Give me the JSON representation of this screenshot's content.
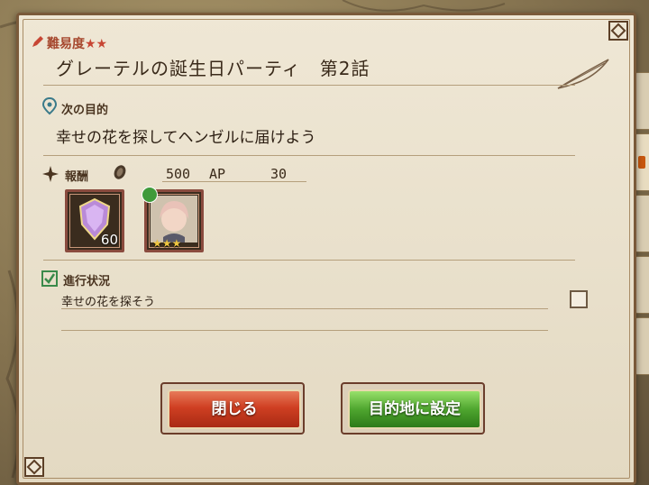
{
  "quest": {
    "difficulty_label": "難易度",
    "difficulty_stars": "★★",
    "title": "グレーテルの誕生日パーティ　第2話"
  },
  "goal": {
    "label": "次の目的",
    "text": "幸せの花を探してヘンゼルに届けよう"
  },
  "reward": {
    "label": "報酬",
    "coin_amount": "500",
    "ap_label": "AP",
    "ap_amount": "30",
    "items": [
      {
        "icon": "crystal-shield-icon",
        "count": "60"
      },
      {
        "icon": "character-portrait-icon",
        "rarity": "★★★"
      }
    ]
  },
  "progress": {
    "label": "進行状況",
    "tasks": [
      {
        "text": "幸せの花を探そう",
        "checked": false
      }
    ]
  },
  "buttons": {
    "close_label": "閉じる",
    "set_destination_label": "目的地に設定"
  },
  "colors": {
    "close_button": "#cf3f22",
    "destination_button": "#4fa62f",
    "panel": "#efe7d5",
    "accent": "#a6482e"
  }
}
